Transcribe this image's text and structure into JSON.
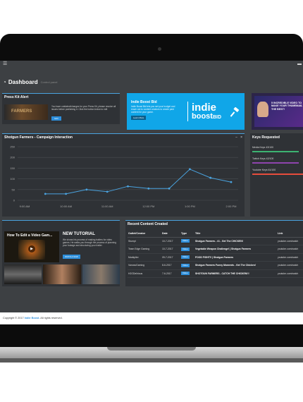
{
  "topbar": {
    "menu_icon": "menu-icon",
    "user_icon": "user-icon"
  },
  "dashboard": {
    "title": "Dashboard",
    "subtitle": "Control panel"
  },
  "press_kit": {
    "title": "Press Kit Alert",
    "thumb_text": "FARMERS",
    "body": "You have outdated/changes for your Press Kit, please resolve all issues before publishing it. Click the button below to edit",
    "button": "Edit"
  },
  "indie_ad": {
    "title": "Indie Boost Bid",
    "body": "Indie Boost Bid lets you set your budget and reach out to content creators to create paid content for your game.",
    "button": "Learn More",
    "logo_line1": "indie",
    "logo_line2": "boost",
    "logo_bid": "BID"
  },
  "yt_ad": {
    "text": "5 INCREDIBLE VIDEO TO MAKE YOUR THUMBNAIL THE BEST!"
  },
  "keys": {
    "title": "Keys Requested",
    "rows": [
      {
        "label": "Media Keys 43/100",
        "fraction": 0.43,
        "color": "#3cb371"
      },
      {
        "label": "Twitch Keys 42/100",
        "fraction": 0.42,
        "color": "#8e44ad"
      },
      {
        "label": "Youtube Keys 61/100",
        "fraction": 0.61,
        "color": "#e74c3c"
      }
    ]
  },
  "campaign": {
    "title": "Shotgun Farmers - Campaign Interaction",
    "controls": [
      "−",
      "×"
    ]
  },
  "chart_data": {
    "type": "line",
    "title": "Shotgun Farmers - Campaign Interaction",
    "x": [
      "10:00 AM",
      "10:30 AM",
      "11:00 AM",
      "11:30 AM",
      "12:00 PM",
      "12:30 PM",
      "1:00 PM",
      "1:30 PM",
      "2:00 PM",
      "2:30 PM"
    ],
    "ticks": [
      "9:00 AM",
      "10:00 AM",
      "11:00 AM",
      "12:00 PM",
      "1:00 PM",
      "2:00 PM"
    ],
    "ytick_labels": [
      "0",
      "50",
      "100",
      "150",
      "200",
      "250"
    ],
    "ylim": [
      0,
      250
    ],
    "values": [
      30,
      30,
      50,
      40,
      65,
      55,
      55,
      145,
      105,
      85
    ],
    "xlabel": "",
    "ylabel": "",
    "grid": true
  },
  "video": {
    "main_title": "How To Edit a Video Gam...",
    "tut_title": "NEW TUTORIAL",
    "tut_body": "We shows his process of making trailers for video games. He walks you through the process of planning your footage and structuring your trailer.",
    "tut_button": "WATCH NOW"
  },
  "recent": {
    "title": "Recent Content Created",
    "columns": [
      "Outlet/Creator",
      "Date",
      "Type",
      "Title",
      "Link"
    ],
    "rows": [
      {
        "creator": "Stumpt",
        "date": "10-7-2017",
        "type": "Video",
        "title": "Shotgun Farmers - #1 - Get The CHICKEN!",
        "link": "youtube.com/watch"
      },
      {
        "creator": "Team Edge Gaming",
        "date": "10-7-2017",
        "type": "Video",
        "title": "Vegetable Weapon Challenge! | Shotgun Farmers",
        "link": "youtube.com/watch"
      },
      {
        "creator": "Markiplier",
        "date": "09-7-2017",
        "type": "Video",
        "title": "FOOD FIGHT!! | Shotgun Farmers",
        "link": "youtube.com/watch"
      },
      {
        "creator": "VanossGaming",
        "date": "8-6-2017",
        "type": "Video",
        "title": "Shotgun Farmers Funny Moments - Get The Chicken!",
        "link": "youtube.com/watch"
      },
      {
        "creator": "H2ODelirious",
        "date": "7-6-2017",
        "type": "Video",
        "title": "SHOTGUN FARMERS - CATCH THE CHICKEN!!!",
        "link": "youtube.com/watch"
      }
    ]
  },
  "footer": {
    "prefix": "Copyright © 2017",
    "brand": "Indie Boost.",
    "suffix": "All rights reserved."
  },
  "colors": {
    "accent": "#2d8fdc",
    "ad_blue": "#10a6e8",
    "panel": "#2f3236",
    "bg": "#3d4043",
    "line": "#4aa3df"
  }
}
